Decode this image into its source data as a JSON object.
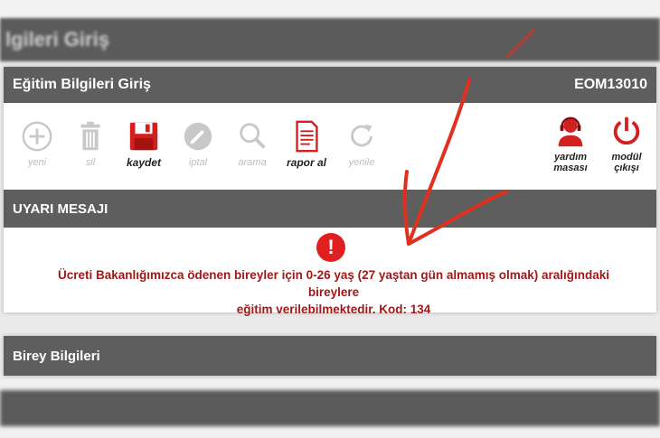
{
  "background": {
    "title": "lgileri Giriş"
  },
  "panel": {
    "title": "Eğitim Bilgileri Giriş",
    "code": "EOM13010"
  },
  "toolbar": {
    "new_label": "yeni",
    "delete_label": "sil",
    "save_label": "kaydet",
    "cancel_label": "iptal",
    "search_label": "arama",
    "report_label": "rapor al",
    "refresh_label": "yenile",
    "help_label": "yardım masası",
    "exit_label": "modül çıkışı"
  },
  "warning": {
    "title": "UYARI MESAJI",
    "icon_text": "!",
    "message_line1": "Ücreti Bakanlığımızca ödenen bireyler için 0-26 yaş (27 yaştan gün almamış olmak) aralığındaki bireylere",
    "message_line2": "eğitim verilebilmektedir. Kod: 134"
  },
  "individual": {
    "title": "Birey Bilgileri"
  },
  "colors": {
    "header_bg": "#5e5e5e",
    "accent_red": "#d41f1f",
    "message_red": "#a01818",
    "disabled_icon": "#c8c8c8",
    "annotation_red": "#e0301e"
  }
}
